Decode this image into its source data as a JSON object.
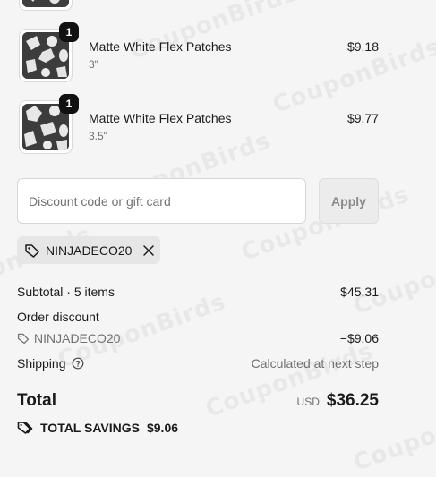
{
  "watermark": "CouponBirds",
  "items": [
    {
      "name": "Matte White Flex Patches",
      "variant": "3\"",
      "price": "$9.18",
      "quantity": "1"
    },
    {
      "name": "Matte White Flex Patches",
      "variant": "3.5\"",
      "price": "$9.77",
      "quantity": "1"
    }
  ],
  "discount": {
    "placeholder": "Discount code or gift card",
    "apply_label": "Apply",
    "applied_code": "NINJADECO20"
  },
  "summary": {
    "subtotal_label": "Subtotal · 5 items",
    "subtotal_value": "$45.31",
    "order_discount_label": "Order discount",
    "discount_code": "NINJADECO20",
    "discount_value": "−$9.06",
    "shipping_label": "Shipping",
    "shipping_value": "Calculated at next step",
    "total_label": "Total",
    "total_currency": "USD",
    "total_value": "$36.25",
    "savings_label": "TOTAL SAVINGS",
    "savings_value": "$9.06"
  },
  "icons": {
    "tag": "tag-icon",
    "close": "close-icon",
    "help": "help-circle-icon"
  }
}
